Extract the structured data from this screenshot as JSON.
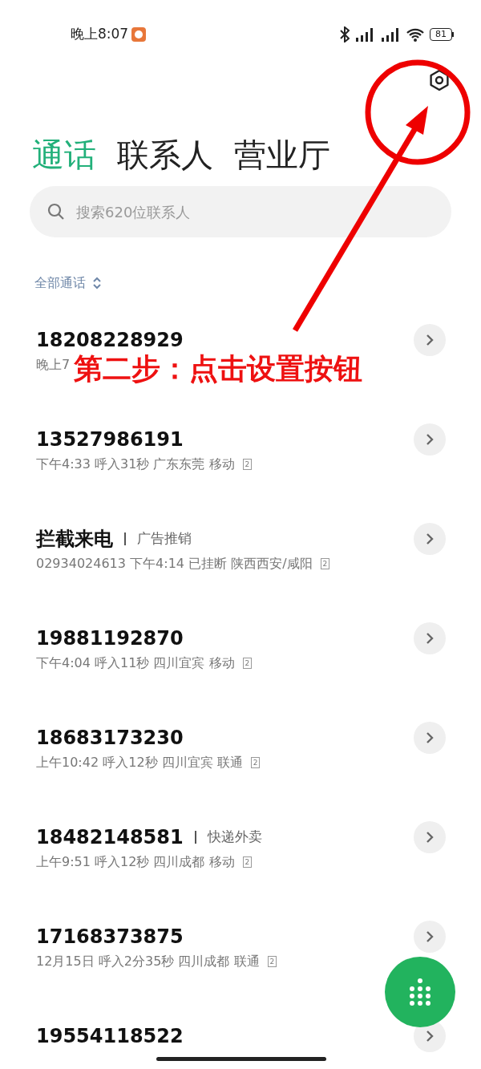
{
  "status_bar": {
    "time": "晚上8:07",
    "battery": "81"
  },
  "tabs": [
    {
      "label": "通话",
      "selected": true
    },
    {
      "label": "联系人",
      "selected": false
    },
    {
      "label": "营业厅",
      "selected": false
    }
  ],
  "search": {
    "placeholder": "搜索620位联系人"
  },
  "filter": {
    "label": "全部通话"
  },
  "calls": [
    {
      "title": "18208228929",
      "detail": "晚上7"
    },
    {
      "title": "13527986191",
      "detail": "下午4:33 呼入31秒 广东东莞 移动",
      "sim": "2"
    },
    {
      "title": "拦截来电",
      "tag": "广告推销",
      "detail": "02934024613 下午4:14 已挂断 陕西西安/咸阳",
      "sim": "2"
    },
    {
      "title": "19881192870",
      "detail": "下午4:04 呼入11秒 四川宜宾 移动",
      "sim": "2"
    },
    {
      "title": "18683173230",
      "detail": "上午10:42 呼入12秒 四川宜宾 联通",
      "sim": "2"
    },
    {
      "title": "18482148581",
      "tag": "快递外卖",
      "detail": "上午9:51 呼入12秒 四川成都 移动",
      "sim": "2"
    },
    {
      "title": "17168373875",
      "detail": "12月15日 呼入2分35秒 四川成都 联通",
      "sim": "2"
    },
    {
      "title": "19554118522"
    }
  ],
  "annotation": {
    "text": "第二步：点击设置按钮"
  }
}
